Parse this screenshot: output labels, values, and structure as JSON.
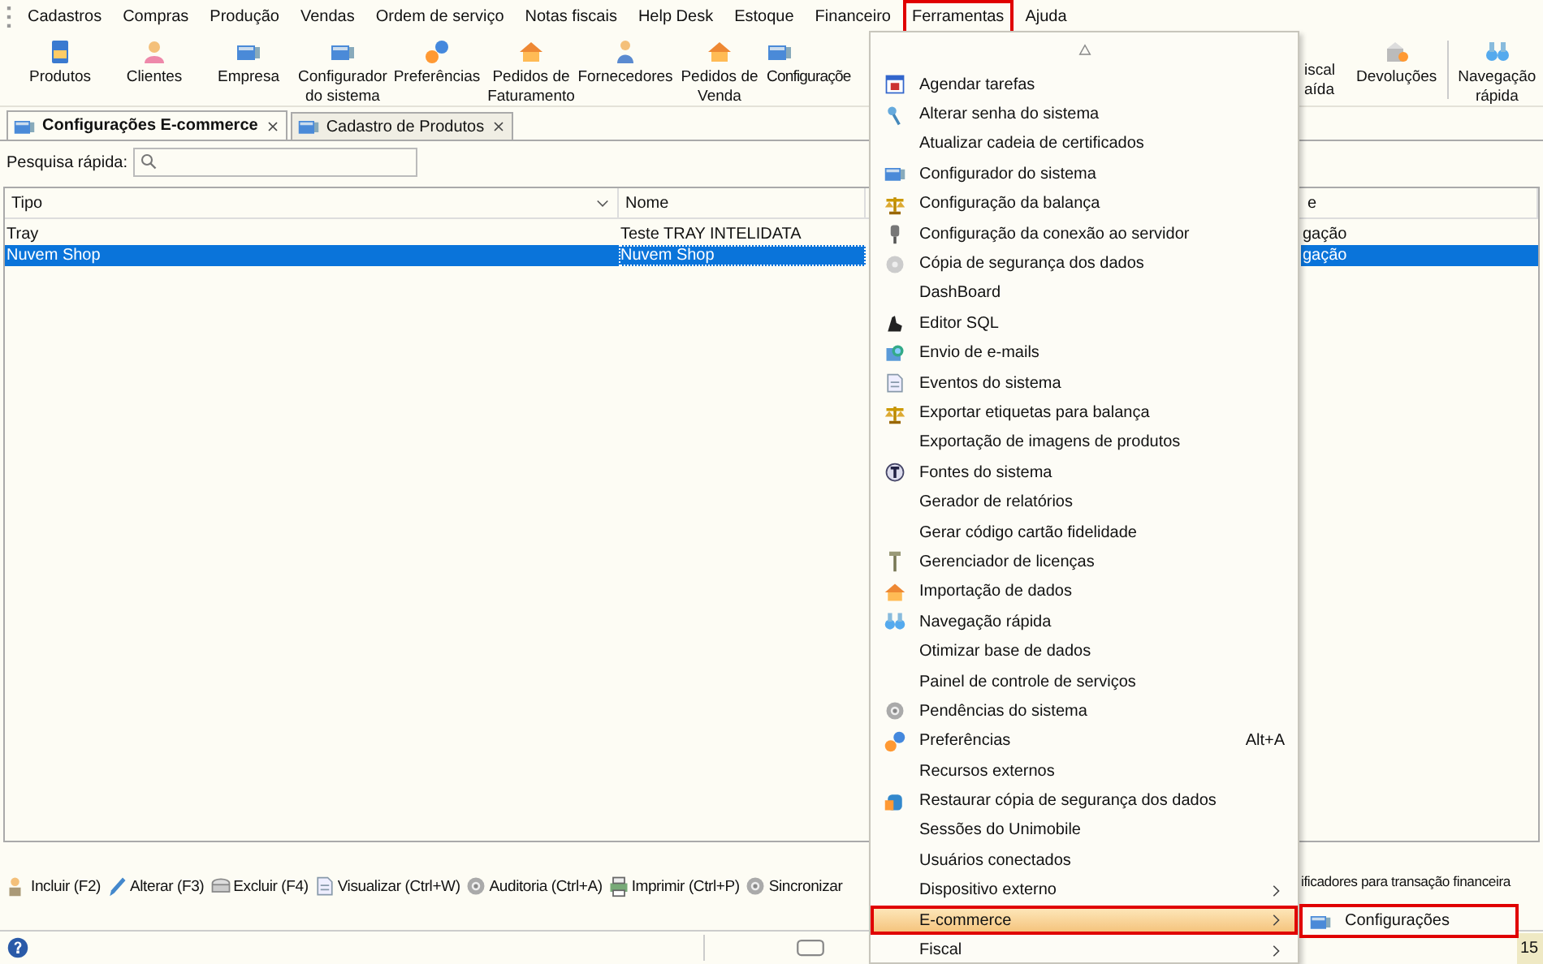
{
  "menu_bar": [
    {
      "label": "Cadastros",
      "annotated": false
    },
    {
      "label": "Compras",
      "annotated": false
    },
    {
      "label": "Produção",
      "annotated": false
    },
    {
      "label": "Vendas",
      "annotated": false
    },
    {
      "label": "Ordem de serviço",
      "annotated": false
    },
    {
      "label": "Notas fiscais",
      "annotated": false
    },
    {
      "label": "Help Desk",
      "annotated": false
    },
    {
      "label": "Estoque",
      "annotated": false
    },
    {
      "label": "Financeiro",
      "annotated": false
    },
    {
      "label": "Ferramentas",
      "annotated": true
    },
    {
      "label": "Ajuda",
      "annotated": false
    }
  ],
  "toolbar": {
    "left": [
      {
        "label": "Produtos"
      },
      {
        "label": "Clientes"
      },
      {
        "label": "Empresa"
      },
      {
        "label": "Configurador\ndo sistema"
      },
      {
        "label": "Preferências"
      },
      {
        "label": "Pedidos de\nFaturamento"
      },
      {
        "label": "Fornecedores"
      },
      {
        "label": "Pedidos de\nVenda"
      },
      {
        "label": "Configuraçõe"
      }
    ],
    "right": [
      {
        "label": "iscal\naída"
      },
      {
        "label": "Devoluções"
      },
      {
        "label": "Navegação\nrápida"
      }
    ]
  },
  "tabs": [
    {
      "label": "Configurações E-commerce",
      "selected": true
    },
    {
      "label": "Cadastro de Produtos",
      "selected": false
    }
  ],
  "search": {
    "label": "Pesquisa rápida:"
  },
  "table": {
    "columns": [
      "Tipo",
      "Nome",
      "e"
    ],
    "rows": [
      {
        "cells": [
          "Tray",
          "Teste TRAY INTELIDATA",
          "gação"
        ],
        "selected": false
      },
      {
        "cells": [
          "Nuvem Shop",
          "Nuvem Shop",
          "gação"
        ],
        "selected": true
      }
    ]
  },
  "actions": [
    "Incluir (F2)",
    "Alterar (F3)",
    "Excluir (F4)",
    "Visualizar (Ctrl+W)",
    "Auditoria (Ctrl+A)",
    "Imprimir (Ctrl+P)",
    "Sincronizar"
  ],
  "actions_tail": "ificadores para transação financeira",
  "status_bar": {
    "count": "15"
  },
  "dropdown_menu": {
    "items": [
      {
        "label": "Agendar tarefas",
        "kind": "item",
        "highlighted": false,
        "annotated": false
      },
      {
        "label": "Alterar senha do sistema",
        "kind": "item",
        "highlighted": false,
        "annotated": false
      },
      {
        "label": "Atualizar cadeia de certificados",
        "kind": "item",
        "highlighted": false,
        "annotated": false
      },
      {
        "label": "Configurador do sistema",
        "kind": "item",
        "highlighted": false,
        "annotated": false
      },
      {
        "label": "Configuração da balança",
        "kind": "item",
        "highlighted": false,
        "annotated": false
      },
      {
        "label": "Configuração da conexão ao servidor",
        "kind": "item",
        "highlighted": false,
        "annotated": false
      },
      {
        "label": "Cópia de segurança dos dados",
        "kind": "item",
        "highlighted": false,
        "annotated": false
      },
      {
        "label": "DashBoard",
        "kind": "item",
        "highlighted": false,
        "annotated": false
      },
      {
        "label": "Editor SQL",
        "kind": "item",
        "highlighted": false,
        "annotated": false
      },
      {
        "label": "Envio de e-mails",
        "kind": "item",
        "highlighted": false,
        "annotated": false
      },
      {
        "label": "Eventos do sistema",
        "kind": "item",
        "highlighted": false,
        "annotated": false
      },
      {
        "label": "Exportar etiquetas para balança",
        "kind": "item",
        "highlighted": false,
        "annotated": false
      },
      {
        "label": "Exportação de imagens de produtos",
        "kind": "item",
        "highlighted": false,
        "annotated": false
      },
      {
        "label": "Fontes do sistema",
        "kind": "item",
        "highlighted": false,
        "annotated": false
      },
      {
        "label": "Gerador de relatórios",
        "kind": "item",
        "highlighted": false,
        "annotated": false
      },
      {
        "label": "Gerar código cartão fidelidade",
        "kind": "item",
        "highlighted": false,
        "annotated": false
      },
      {
        "label": "Gerenciador de licenças",
        "kind": "item",
        "highlighted": false,
        "annotated": false
      },
      {
        "label": "Importação de dados",
        "kind": "item",
        "highlighted": false,
        "annotated": false
      },
      {
        "label": "Navegação rápida",
        "kind": "item",
        "highlighted": false,
        "annotated": false
      },
      {
        "label": "Otimizar base de dados",
        "kind": "item",
        "highlighted": false,
        "annotated": false
      },
      {
        "label": "Painel de controle de serviços",
        "kind": "item",
        "highlighted": false,
        "annotated": false
      },
      {
        "label": "Pendências do sistema",
        "kind": "item",
        "highlighted": false,
        "annotated": false
      },
      {
        "label": "Preferências",
        "kind": "item",
        "shortcut": "Alt+A",
        "highlighted": false,
        "annotated": false
      },
      {
        "label": "Recursos externos",
        "kind": "item",
        "highlighted": false,
        "annotated": false
      },
      {
        "label": "Restaurar cópia de segurança dos dados",
        "kind": "item",
        "highlighted": false,
        "annotated": false
      },
      {
        "label": "Sessões do Unimobile",
        "kind": "item",
        "highlighted": false,
        "annotated": false
      },
      {
        "label": "Usuários conectados",
        "kind": "item",
        "highlighted": false,
        "annotated": false
      },
      {
        "label": "Dispositivo externo",
        "kind": "submenu",
        "highlighted": false,
        "annotated": false
      },
      {
        "label": "E-commerce",
        "kind": "submenu",
        "highlighted": true,
        "annotated": true
      },
      {
        "label": "Fiscal",
        "kind": "submenu",
        "highlighted": false,
        "annotated": false
      }
    ]
  },
  "submenu": {
    "items": [
      {
        "label": "Configurações",
        "annotated": true
      }
    ]
  }
}
